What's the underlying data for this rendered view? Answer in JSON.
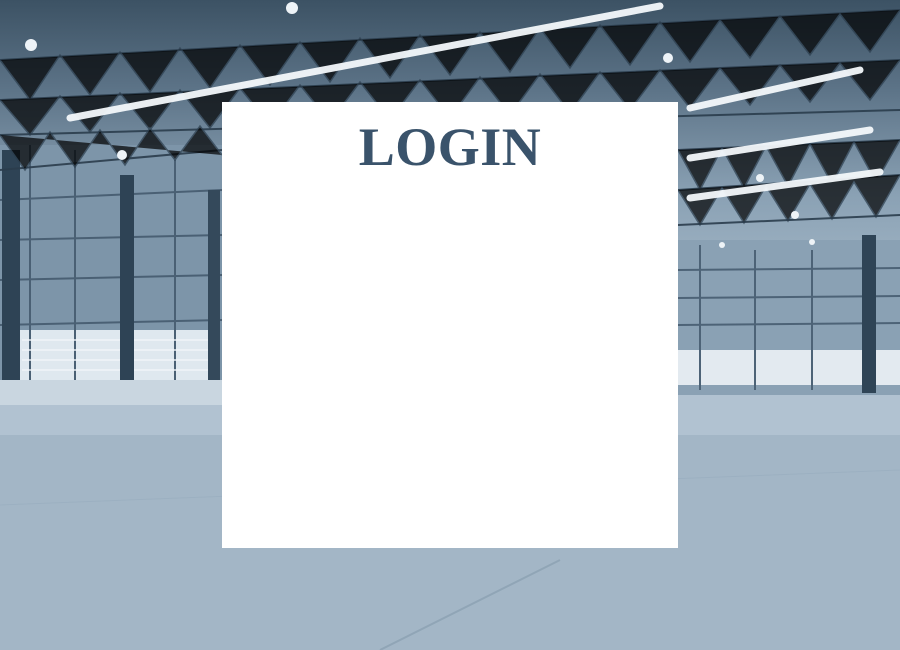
{
  "login": {
    "title": "LOGIN"
  },
  "colors": {
    "title": "#3a536b",
    "panel": "#ffffff",
    "background_tint": "#8ea6b8"
  },
  "background": {
    "scene": "warehouse-interior-photo"
  }
}
